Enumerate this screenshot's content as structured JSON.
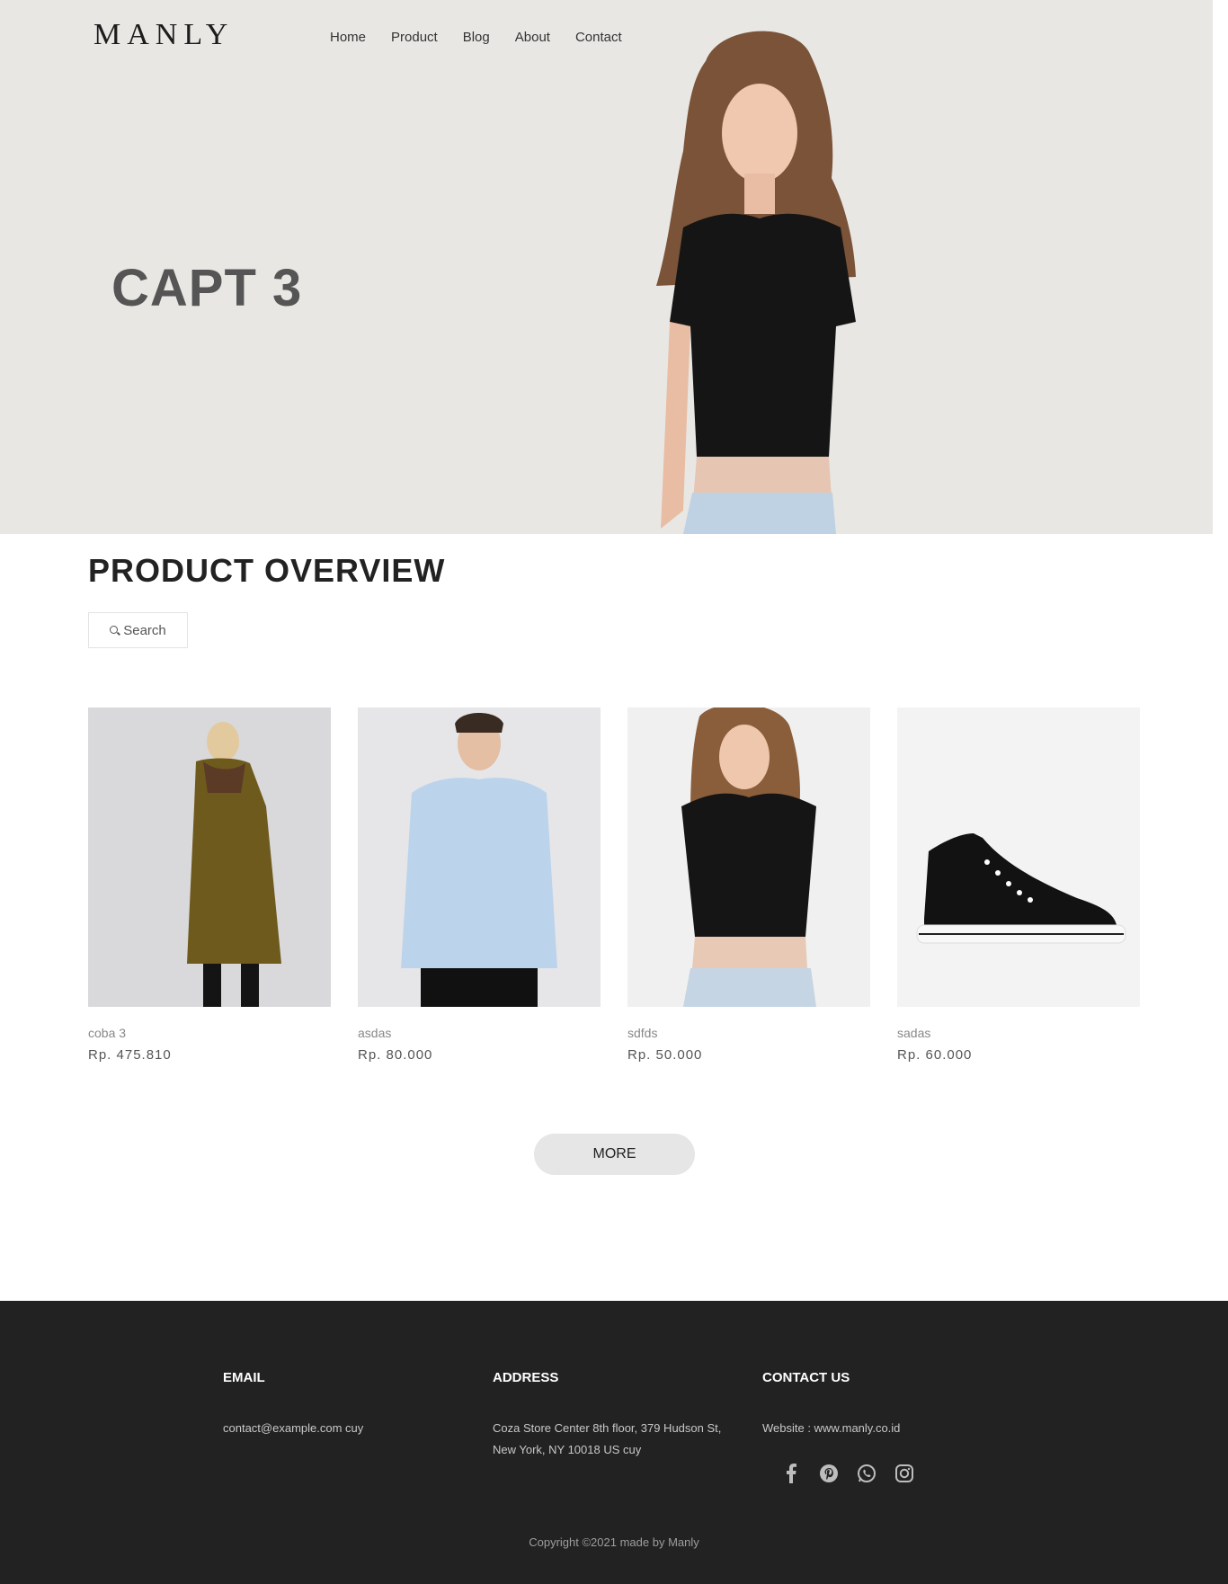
{
  "brand": {
    "logo": "MANLY"
  },
  "nav": {
    "items": [
      "Home",
      "Product",
      "Blog",
      "About",
      "Contact"
    ]
  },
  "hero": {
    "caption": "CAPT 3"
  },
  "overview": {
    "title": "PRODUCT OVERVIEW",
    "search_label": "Search",
    "products": [
      {
        "name": "coba 3",
        "price": "Rp. 475.810"
      },
      {
        "name": "asdas",
        "price": "Rp. 80.000"
      },
      {
        "name": "sdfds",
        "price": "Rp. 50.000"
      },
      {
        "name": "sadas",
        "price": "Rp. 60.000"
      }
    ],
    "more_label": "MORE"
  },
  "footer": {
    "email_heading": "EMAIL",
    "email_value": "contact@example.com cuy",
    "address_heading": "ADDRESS",
    "address_value": "Coza Store Center 8th floor, 379 Hudson St, New York, NY 10018 US cuy",
    "contact_heading": "CONTACT US",
    "website": "Website : www.manly.co.id",
    "social_icons": [
      "facebook-icon",
      "pinterest-icon",
      "whatsapp-icon",
      "instagram-icon"
    ],
    "copyright": "Copyright ©2021 made by Manly"
  },
  "colors": {
    "hero_bg": "#e9e7e4",
    "footer_bg": "#222222",
    "more_bg": "#e6e6e6"
  }
}
